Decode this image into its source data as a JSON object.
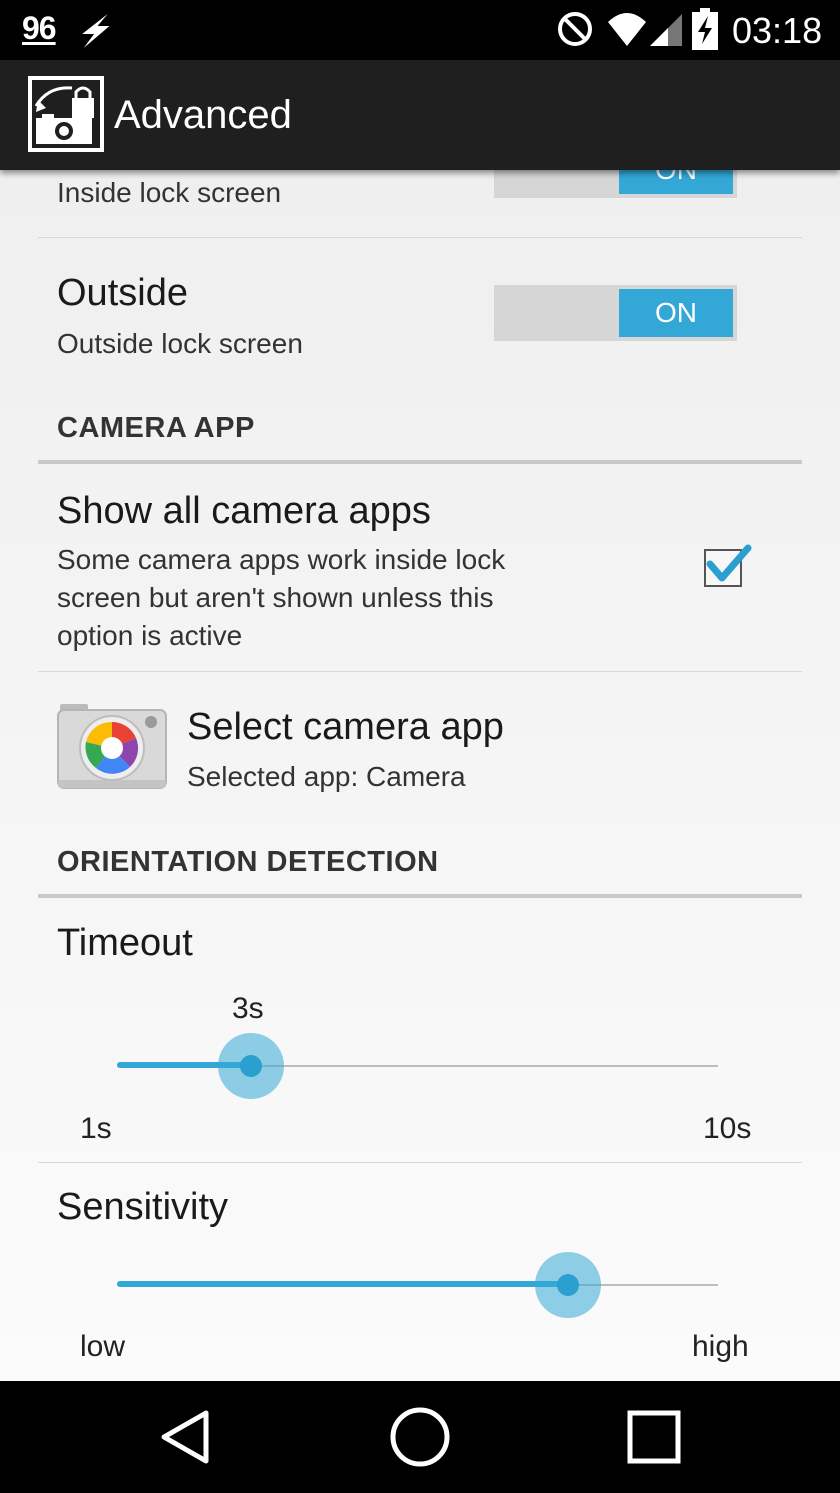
{
  "status_bar": {
    "battery_level": "96",
    "time": "03:18",
    "icons": [
      "charging-bolt-icon",
      "do-not-disturb-icon",
      "wifi-icon",
      "cell-signal-icon",
      "battery-charging-icon"
    ]
  },
  "app_bar": {
    "title": "Advanced",
    "icon": "lockscreen-camera-app-icon"
  },
  "prefs": {
    "inside": {
      "summary": "Inside lock screen",
      "toggle": "ON"
    },
    "outside": {
      "title": "Outside",
      "summary": "Outside lock screen",
      "toggle": "ON"
    },
    "camera_section": "CAMERA APP",
    "show_all": {
      "title": "Show all camera apps",
      "summary_lines": [
        "Some camera apps work inside lock",
        "screen but aren't shown unless this",
        "option is active"
      ],
      "checked": true
    },
    "select_camera": {
      "title": "Select camera app",
      "summary": "Selected app: Camera",
      "icon": "camera-app-icon"
    },
    "orientation_section": "ORIENTATION DETECTION",
    "timeout": {
      "title": "Timeout",
      "value_label": "3s",
      "min_label": "1s",
      "max_label": "10s",
      "value": 3,
      "min": 1,
      "max": 10
    },
    "sensitivity": {
      "title": "Sensitivity",
      "min_label": "low",
      "max_label": "high",
      "value_fraction": 0.75
    }
  },
  "colors": {
    "accent": "#33a7d6",
    "app_bar": "#1f1f1f",
    "background": "#efefef"
  },
  "nav_bar": {
    "icons": [
      "back-icon",
      "home-icon",
      "recents-icon"
    ]
  }
}
